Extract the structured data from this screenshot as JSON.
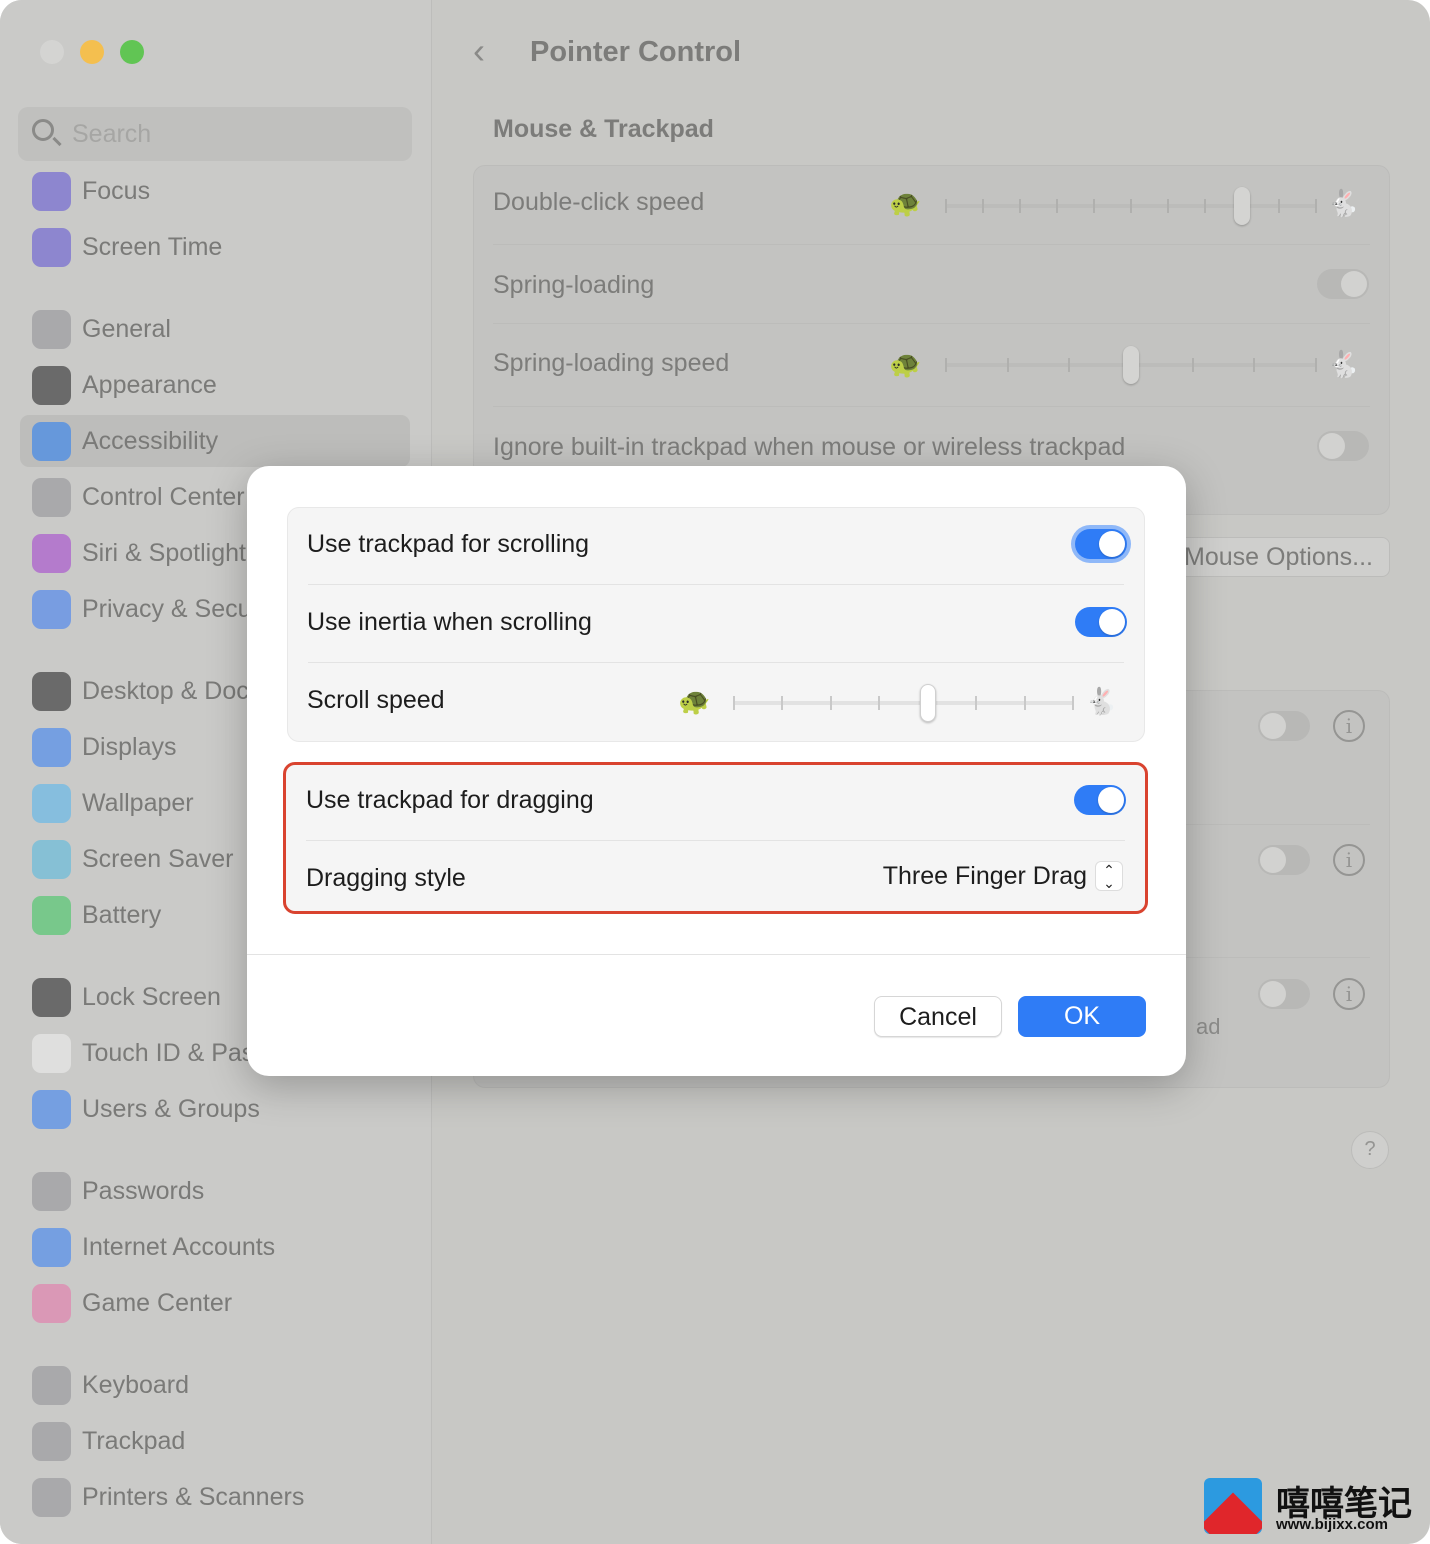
{
  "window": {
    "traffic_lights": {
      "close": "#d4d4d2",
      "minimize": "#f4bf4f",
      "zoom": "#61c554"
    }
  },
  "sidebar": {
    "search_placeholder": "Search",
    "items": [
      {
        "label": "Focus",
        "icon": "moon-icon",
        "color": "#5b4fd6"
      },
      {
        "label": "Screen Time",
        "icon": "hourglass-icon",
        "color": "#5b4fd6"
      },
      {
        "label": "General",
        "icon": "gear-icon",
        "color": "#8e8e93"
      },
      {
        "label": "Appearance",
        "icon": "appearance-icon",
        "color": "#1c1c1e"
      },
      {
        "label": "Accessibility",
        "icon": "accessibility-icon",
        "color": "#1f7af5",
        "selected": true
      },
      {
        "label": "Control Center",
        "icon": "toggles-icon",
        "color": "#8e8e93"
      },
      {
        "label": "Siri & Spotlight",
        "icon": "siri-icon",
        "color": "#a23ad0"
      },
      {
        "label": "Privacy & Security",
        "icon": "hand-icon",
        "color": "#3478f6"
      },
      {
        "label": "Desktop & Dock",
        "icon": "dock-icon",
        "color": "#1c1c1e"
      },
      {
        "label": "Displays",
        "icon": "sun-icon",
        "color": "#2f7cf6"
      },
      {
        "label": "Wallpaper",
        "icon": "flower-icon",
        "color": "#4fb5f0"
      },
      {
        "label": "Screen Saver",
        "icon": "screensaver-icon",
        "color": "#4fb8e0"
      },
      {
        "label": "Battery",
        "icon": "battery-icon",
        "color": "#34c759"
      },
      {
        "label": "Lock Screen",
        "icon": "lock-icon",
        "color": "#1c1c1e"
      },
      {
        "label": "Touch ID & Password",
        "icon": "fingerprint-icon",
        "color": "#f0f0f0"
      },
      {
        "label": "Users & Groups",
        "icon": "users-icon",
        "color": "#2f7cf6"
      },
      {
        "label": "Passwords",
        "icon": "key-icon",
        "color": "#8e8e93"
      },
      {
        "label": "Internet Accounts",
        "icon": "at-icon",
        "color": "#2f7cf6"
      },
      {
        "label": "Game Center",
        "icon": "game-center-icon",
        "color": "#e86fa8"
      },
      {
        "label": "Keyboard",
        "icon": "keyboard-icon",
        "color": "#8e8e93"
      },
      {
        "label": "Trackpad",
        "icon": "trackpad-icon",
        "color": "#8e8e93"
      },
      {
        "label": "Printers & Scanners",
        "icon": "printer-icon",
        "color": "#8e8e93"
      }
    ]
  },
  "main": {
    "back_icon": "chevron-left-icon",
    "title": "Pointer Control",
    "section": "Mouse & Trackpad",
    "rows": {
      "double_click": {
        "label": "Double-click speed",
        "positions": 11,
        "value_index": 8
      },
      "spring_loading": {
        "label": "Spring-loading",
        "on": true
      },
      "spring_speed": {
        "label": "Spring-loading speed",
        "positions": 7,
        "value_index": 3
      },
      "ignore": {
        "label": "Ignore built-in trackpad when mouse or wireless trackpad",
        "on": false
      }
    },
    "mouse_options": "Mouse Options...",
    "partial_text": "ad",
    "help": "?"
  },
  "dialog": {
    "scrolling": {
      "label": "Use trackpad for scrolling",
      "on": true
    },
    "inertia": {
      "label": "Use inertia when scrolling",
      "on": true
    },
    "scroll_speed": {
      "label": "Scroll speed",
      "positions": 8,
      "value_index": 4
    },
    "dragging": {
      "label": "Use trackpad for dragging",
      "on": true
    },
    "dragging_style": {
      "label": "Dragging style",
      "value": "Three Finger Drag"
    },
    "cancel": "Cancel",
    "ok": "OK",
    "highlight_color": "#d9432f",
    "accent": "#2f7cf6"
  },
  "watermark": {
    "text": "嘻嘻笔记",
    "url": "www.bijixx.com"
  }
}
